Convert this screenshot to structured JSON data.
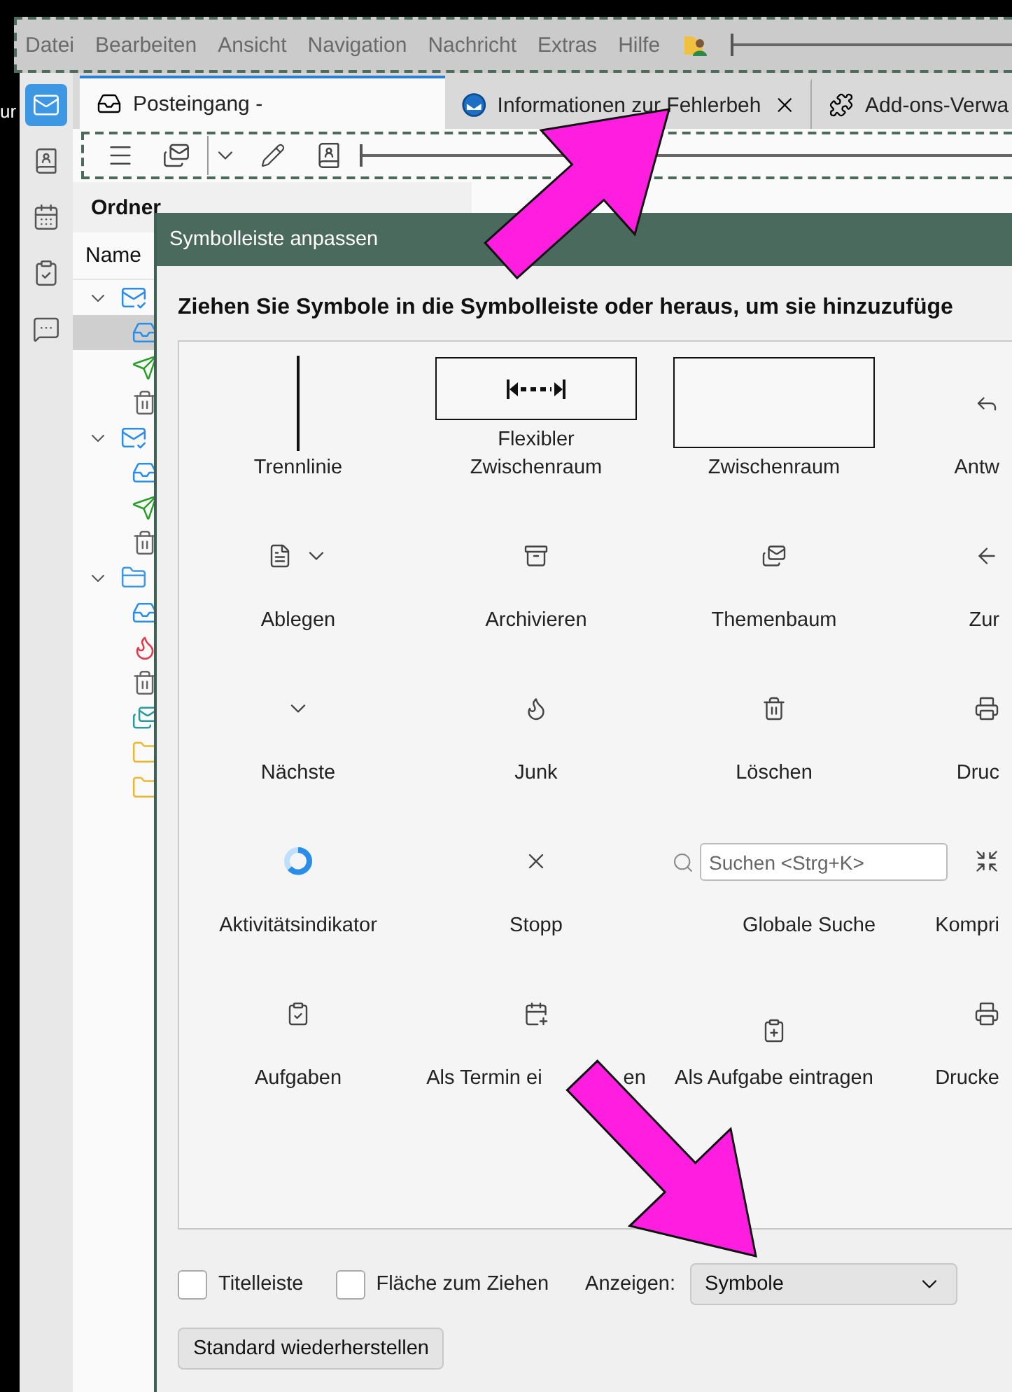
{
  "edge_text": "ur",
  "menu_bar": {
    "items": [
      "Datei",
      "Bearbeiten",
      "Ansicht",
      "Navigation",
      "Nachricht",
      "Extras",
      "Hilfe"
    ],
    "icons": [
      {
        "kind": "address-book"
      },
      {
        "kind": "flex-space"
      }
    ]
  },
  "spaces": [
    {
      "kind": "mail",
      "selected": true
    },
    {
      "kind": "address-book",
      "selected": false
    },
    {
      "kind": "calendar",
      "selected": false
    },
    {
      "kind": "tasks",
      "selected": false
    },
    {
      "kind": "chat",
      "selected": false
    }
  ],
  "tabs": [
    {
      "label": "Posteingang -",
      "kind": "inbox",
      "selected": true,
      "closable": false
    },
    {
      "label": "Informationen zur Fehlerbeh",
      "kind": "app",
      "selected": false,
      "closable": true
    },
    {
      "label": "Add-ons-Verwa",
      "kind": "addons",
      "selected": false
    }
  ],
  "toolbar": [
    {
      "kind": "menu"
    },
    {
      "kind": "get-mail"
    },
    {
      "kind": "split-chevron"
    },
    {
      "kind": "write"
    },
    {
      "kind": "address-book"
    },
    {
      "kind": "flex-space"
    }
  ],
  "folder_pane": {
    "title": "Ordner",
    "column": "Name",
    "folders": [
      {
        "kind": "account",
        "expanded": true,
        "selected": false,
        "children": [
          {
            "kind": "inbox",
            "selected": true
          },
          {
            "kind": "sent",
            "selected": false
          },
          {
            "kind": "trash",
            "selected": false
          }
        ]
      },
      {
        "kind": "account",
        "expanded": true,
        "selected": false,
        "children": [
          {
            "kind": "inbox",
            "selected": false
          },
          {
            "kind": "sent",
            "selected": false
          },
          {
            "kind": "trash",
            "selected": false
          }
        ]
      },
      {
        "kind": "local",
        "expanded": true,
        "selected": false,
        "children": [
          {
            "kind": "inbox",
            "selected": false
          },
          {
            "kind": "junk",
            "selected": false
          },
          {
            "kind": "trash",
            "selected": false
          },
          {
            "kind": "outbox",
            "selected": false
          },
          {
            "kind": "folder",
            "selected": false
          },
          {
            "kind": "folder",
            "selected": false
          }
        ]
      }
    ]
  },
  "dialog": {
    "title": "Symbolleiste anpassen",
    "heading": "Ziehen Sie Symbole in die Symbolleiste oder heraus, um sie hinzuzufüge",
    "palette": [
      {
        "kind": "separator",
        "label": "Trennlinie"
      },
      {
        "kind": "flex-space",
        "label": "Flexibler Zwischenraum"
      },
      {
        "kind": "space",
        "label": "Zwischenraum"
      },
      {
        "kind": "reply",
        "label": "Antw"
      },
      {
        "kind": "file",
        "label": "Ablegen"
      },
      {
        "kind": "archive",
        "label": "Archivieren"
      },
      {
        "kind": "threads",
        "label": "Themenbaum"
      },
      {
        "kind": "back",
        "label": "Zur"
      },
      {
        "kind": "next",
        "label": "Nächste"
      },
      {
        "kind": "junk",
        "label": "Junk"
      },
      {
        "kind": "delete",
        "label": "Löschen"
      },
      {
        "kind": "print",
        "label": "Druc"
      },
      {
        "kind": "spinner",
        "label": "Aktivitätsindikator"
      },
      {
        "kind": "stop",
        "label": "Stopp"
      },
      {
        "kind": "search",
        "label": "Globale Suche",
        "placeholder": "Suchen <Strg+K>"
      },
      {
        "kind": "compact",
        "label": "Kompri"
      },
      {
        "kind": "tasks",
        "label": "Aufgaben"
      },
      {
        "kind": "add-event",
        "label": "Als Termin ei",
        "label_after": "en"
      },
      {
        "kind": "add-task",
        "label": "Als Aufgabe eintragen"
      },
      {
        "kind": "print",
        "label": "Drucke"
      }
    ],
    "checkboxes": [
      {
        "label": "Titelleiste",
        "checked": false
      },
      {
        "label": "Fläche zum Ziehen",
        "checked": false
      }
    ],
    "show_label": "Anzeigen:",
    "show_value": "Symbole",
    "restore_button": "Standard wiederherstellen"
  }
}
